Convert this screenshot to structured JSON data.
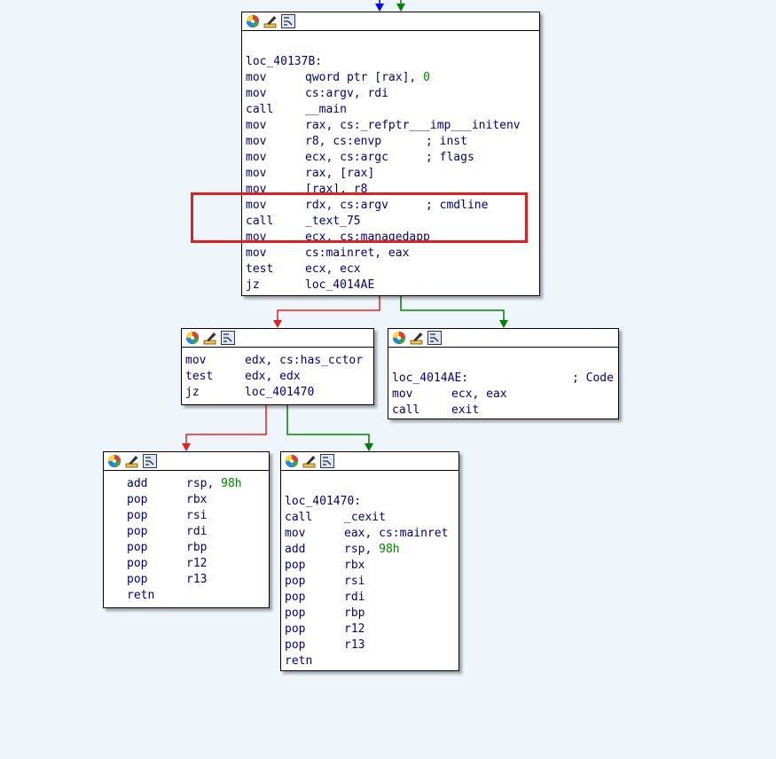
{
  "nodes": {
    "main_block": {
      "label": "loc_40137B:",
      "lines": [
        {
          "mn": "mov",
          "op": "qword ptr [rax], ",
          "num": "0"
        },
        {
          "mn": "mov",
          "op": "cs:argv, rdi"
        },
        {
          "mn": "call",
          "op": "__main"
        },
        {
          "mn": "mov",
          "op": "rax, cs:_refptr___imp___initenv"
        },
        {
          "mn": "mov",
          "op": "r8, cs:envp",
          "cmt": "; inst"
        },
        {
          "mn": "mov",
          "op": "ecx, cs:argc",
          "cmt": "; flags"
        },
        {
          "mn": "mov",
          "op": "rax, [rax]"
        },
        {
          "mn": "mov",
          "op": "[rax], r8"
        },
        {
          "mn": "mov",
          "op": "rdx, cs:argv",
          "cmt": "; cmdline"
        },
        {
          "mn": "call",
          "op": "_text_75"
        },
        {
          "mn": "mov",
          "op": "ecx, cs:managedapp"
        },
        {
          "mn": "mov",
          "op": "cs:mainret, eax"
        },
        {
          "mn": "test",
          "op": "ecx, ecx"
        },
        {
          "mn": "jz",
          "op": "loc_4014AE"
        }
      ]
    },
    "cctor_block": {
      "lines": [
        {
          "mn": "mov",
          "op": "edx, cs:has_cctor"
        },
        {
          "mn": "test",
          "op": "edx, edx"
        },
        {
          "mn": "jz",
          "op": "loc_401470"
        }
      ]
    },
    "exit_block": {
      "label": "loc_4014AE:",
      "label_comment": "; Code",
      "lines": [
        {
          "mn": "mov",
          "op": "ecx, eax"
        },
        {
          "mn": "call",
          "op": "exit"
        }
      ]
    },
    "ret_block": {
      "lines": [
        {
          "mn": "add",
          "op": "rsp, ",
          "num": "98h"
        },
        {
          "mn": "pop",
          "op": "rbx"
        },
        {
          "mn": "pop",
          "op": "rsi"
        },
        {
          "mn": "pop",
          "op": "rdi"
        },
        {
          "mn": "pop",
          "op": "rbp"
        },
        {
          "mn": "pop",
          "op": "r12"
        },
        {
          "mn": "pop",
          "op": "r13"
        },
        {
          "mn": "retn",
          "op": ""
        }
      ]
    },
    "cexit_block": {
      "label": "loc_401470:",
      "lines": [
        {
          "mn": "call",
          "op": "_cexit"
        },
        {
          "mn": "mov",
          "op": "eax, cs:mainret"
        },
        {
          "mn": "add",
          "op": "rsp, ",
          "num": "98h"
        },
        {
          "mn": "pop",
          "op": "rbx"
        },
        {
          "mn": "pop",
          "op": "rsi"
        },
        {
          "mn": "pop",
          "op": "rdi"
        },
        {
          "mn": "pop",
          "op": "rbp"
        },
        {
          "mn": "pop",
          "op": "r12"
        },
        {
          "mn": "pop",
          "op": "r13"
        },
        {
          "mn": "retn",
          "op": ""
        }
      ]
    }
  },
  "header_icons": [
    "color-palette-icon",
    "rename-pencil-icon",
    "graph-view-icon"
  ],
  "colors": {
    "background": "#eef6fc",
    "edge_true": "#008000",
    "edge_false": "#e8201c",
    "edge_unconditional": "#0000ff",
    "highlight_box": "#e0201e",
    "code_text": "#000080",
    "number_text": "#008000"
  }
}
